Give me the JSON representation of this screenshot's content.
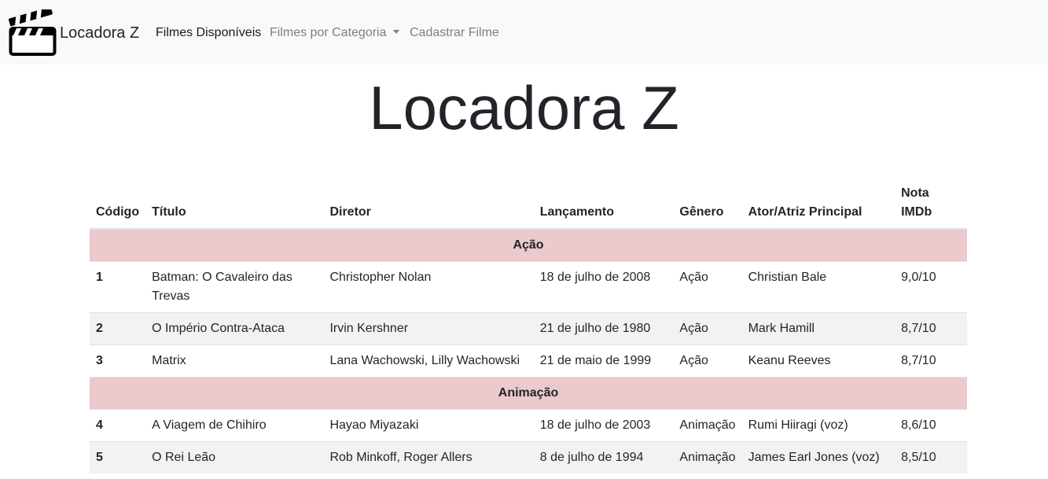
{
  "navbar": {
    "brand": "Locadora Z",
    "links": [
      {
        "label": "Filmes Disponíveis",
        "active": true
      },
      {
        "label": "Filmes por Categoria",
        "dropdown": true
      },
      {
        "label": "Cadastrar Filme"
      }
    ]
  },
  "page": {
    "title": "Locadora Z"
  },
  "table": {
    "headers": [
      "Código",
      "Título",
      "Diretor",
      "Lançamento",
      "Gênero",
      "Ator/Atriz Principal",
      "Nota IMDb"
    ],
    "categories": [
      {
        "name": "Ação",
        "rows": [
          {
            "code": "1",
            "title": "Batman: O Cavaleiro das Trevas",
            "director": "Christopher Nolan",
            "release": "18 de julho de 2008",
            "genre": "Ação",
            "actor": "Christian Bale",
            "rating": "9,0/10"
          },
          {
            "code": "2",
            "title": "O Império Contra-Ataca",
            "director": "Irvin Kershner",
            "release": "21 de julho de 1980",
            "genre": "Ação",
            "actor": "Mark Hamill",
            "rating": "8,7/10"
          },
          {
            "code": "3",
            "title": "Matrix",
            "director": "Lana Wachowski, Lilly Wachowski",
            "release": "21 de maio de 1999",
            "genre": "Ação",
            "actor": "Keanu Reeves",
            "rating": "8,7/10"
          }
        ]
      },
      {
        "name": "Animação",
        "rows": [
          {
            "code": "4",
            "title": "A Viagem de Chihiro",
            "director": "Hayao Miyazaki",
            "release": "18 de julho de 2003",
            "genre": "Animação",
            "actor": "Rumi Hiiragi (voz)",
            "rating": "8,6/10"
          },
          {
            "code": "5",
            "title": "O Rei Leão",
            "director": "Rob Minkoff, Roger Allers",
            "release": "8 de julho de 1994",
            "genre": "Animação",
            "actor": "James Earl Jones (voz)",
            "rating": "8,5/10"
          }
        ]
      }
    ]
  }
}
